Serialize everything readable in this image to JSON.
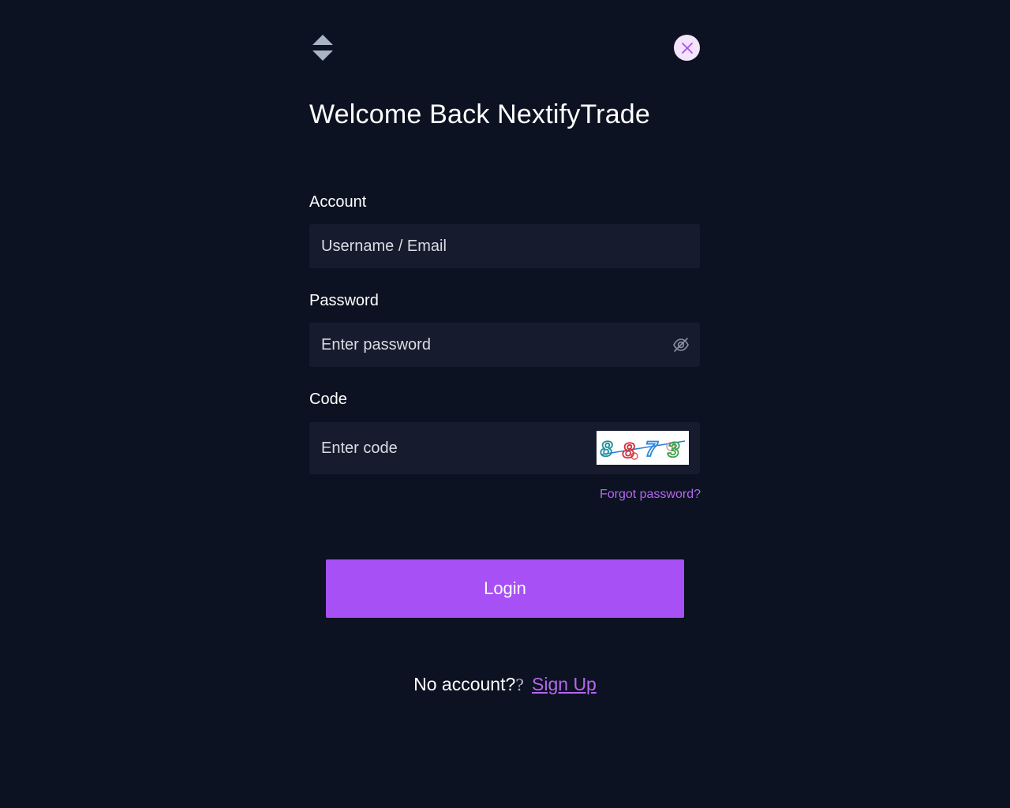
{
  "header": {
    "logo_icon": "double-triangle-logo-icon",
    "close_icon": "close-icon"
  },
  "title": "Welcome Back NextifyTrade",
  "form": {
    "account": {
      "label": "Account",
      "placeholder": "Username / Email",
      "value": ""
    },
    "password": {
      "label": "Password",
      "placeholder": "Enter password",
      "value": "",
      "toggle_icon": "eye-off-icon"
    },
    "code": {
      "label": "Code",
      "placeholder": "Enter code",
      "value": "",
      "captcha_text": "8873"
    },
    "forgot_label": "Forgot password?",
    "login_label": "Login"
  },
  "signup": {
    "prompt": "No account?",
    "link_label": "Sign Up"
  },
  "colors": {
    "background": "#0c1221",
    "field_background": "#161c2d",
    "accent": "#a650f5",
    "link": "#b467f0",
    "close_background": "#f4e4fb"
  }
}
